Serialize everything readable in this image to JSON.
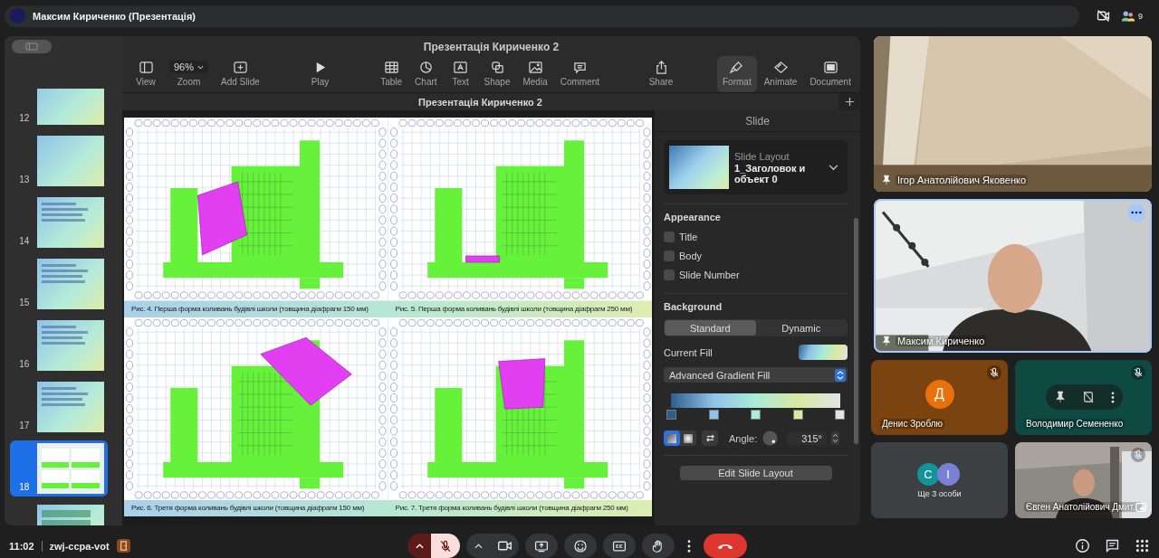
{
  "meet_bar": {
    "title": "Максим Кириченко (Презентація)",
    "participant_count": "9"
  },
  "keynote": {
    "window_title": "Презентація Кириченко 2",
    "toolbar": [
      [
        {
          "kind": "view",
          "label": "View",
          "selected": false
        },
        {
          "kind": "zoom",
          "label": "Zoom",
          "value": "96%",
          "selected": false
        },
        {
          "kind": "add-slide",
          "label": "Add Slide",
          "selected": false
        }
      ],
      [
        {
          "kind": "play",
          "label": "Play",
          "selected": false
        }
      ],
      [
        {
          "kind": "table",
          "label": "Table",
          "selected": false
        },
        {
          "kind": "chart",
          "label": "Chart",
          "selected": false
        },
        {
          "kind": "text",
          "label": "Text",
          "selected": false
        },
        {
          "kind": "shape",
          "label": "Shape",
          "selected": false
        },
        {
          "kind": "media",
          "label": "Media",
          "selected": false
        },
        {
          "kind": "comment",
          "label": "Comment",
          "selected": false
        }
      ],
      [
        {
          "kind": "share",
          "label": "Share",
          "selected": false
        }
      ],
      [
        {
          "kind": "format",
          "label": "Format",
          "selected": true
        },
        {
          "kind": "animate",
          "label": "Animate",
          "selected": false
        },
        {
          "kind": "document",
          "label": "Document",
          "selected": false
        }
      ]
    ],
    "document_tab": "Презентація Кириченко 2",
    "slides": [
      {
        "number": "12",
        "selected": false
      },
      {
        "number": "13",
        "selected": false
      },
      {
        "number": "14",
        "selected": false
      },
      {
        "number": "15",
        "selected": false
      },
      {
        "number": "16",
        "selected": false
      },
      {
        "number": "17",
        "selected": false
      },
      {
        "number": "18",
        "selected": true
      },
      {
        "selected": false
      }
    ],
    "figures": [
      {
        "caption": "Рис. 4. Перша форма коливань будівлі школи (товщина діафрагм 150 мм)"
      },
      {
        "caption": "Рис. 5. Перша форма коливань будівлі школи (товщина діафрагм 250 мм)"
      },
      {
        "caption": "Рис. 6. Третя форма коливань будівлі школи (товщина діафрагм 150 мм)"
      },
      {
        "caption": "Рис. 7. Третя форма коливань будівлі школи (товщина діафрагм 250 мм)"
      }
    ],
    "inspector": {
      "title": "Slide",
      "layout_label": "Slide Layout",
      "layout_name": "1_Заголовок и объект 0",
      "appearance_heading": "Appearance",
      "appearance": [
        {
          "label": "Title",
          "checked": false
        },
        {
          "label": "Body",
          "checked": false
        },
        {
          "label": "Slide Number",
          "checked": false
        }
      ],
      "background_heading": "Background",
      "background_modes": [
        {
          "label": "Standard",
          "selected": true
        },
        {
          "label": "Dynamic",
          "selected": false
        }
      ],
      "current_fill_label": "Current Fill",
      "fill_type": "Advanced Gradient Fill",
      "gradient_stops": [
        {
          "color": "#2d5f8a"
        },
        {
          "color": "#8fc3ea"
        },
        {
          "color": "#a8ecd6"
        },
        {
          "color": "#d8eaa0"
        },
        {
          "color": "#e0e4e6"
        }
      ],
      "gradient_types": [
        {
          "kind": "linear",
          "selected": true
        },
        {
          "kind": "radial",
          "selected": false
        }
      ],
      "angle_label": "Angle:",
      "angle_value": "315°",
      "edit_button": "Edit Slide Layout"
    }
  },
  "participants": [
    {
      "kind": "video",
      "name": "Ігор Анатолійович Яковенко",
      "pinned": true,
      "muted": false,
      "highlighted": false,
      "controls_shown": false
    },
    {
      "kind": "video",
      "name": "Максим Кириченко",
      "pinned": true,
      "muted": false,
      "highlighted": true,
      "controls_shown": false
    },
    {
      "kind": "avatar",
      "name": "Денис Зроблю",
      "avatar": {
        "letter": "Д",
        "color": "#e8710a"
      },
      "color": "#7a430f",
      "pinned": false,
      "muted": true,
      "highlighted": false,
      "controls_shown": false
    },
    {
      "kind": "avatar",
      "name": "Володимир Семененко",
      "color": "#0f4a42",
      "pinned": false,
      "muted": true,
      "highlighted": false,
      "controls_shown": true
    },
    {
      "kind": "others",
      "label": "Ще 3 особи",
      "avatars": [
        {
          "letter": "С",
          "color": "#12939a"
        },
        {
          "letter": "І",
          "color": "#7c7fd6"
        }
      ],
      "pinned": false,
      "muted": false,
      "highlighted": false,
      "controls_shown": false
    },
    {
      "kind": "video",
      "name": "Євген Анатолійович Дмит...",
      "pinned": false,
      "muted": true,
      "highlighted": false,
      "controls_shown": false
    }
  ],
  "bottom_bar": {
    "time": "11:02",
    "meeting_code": "zwj-ccpa-vot",
    "mic": {
      "on": false
    },
    "camera": {
      "on": true
    }
  }
}
